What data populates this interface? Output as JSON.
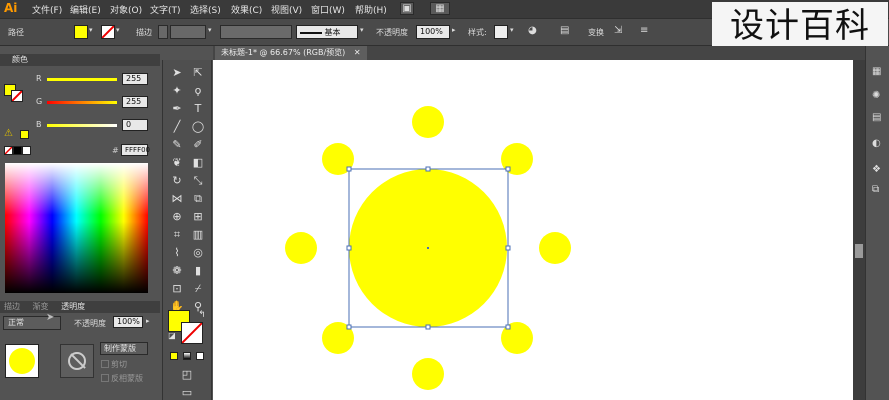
{
  "app": {
    "logo": "Ai"
  },
  "menu": [
    "文件(F)",
    "编辑(E)",
    "对象(O)",
    "文字(T)",
    "选择(S)",
    "效果(C)",
    "视图(V)",
    "窗口(W)",
    "帮助(H)"
  ],
  "control_bar": {
    "selection_label": "路径",
    "fill_color": "#ffff00",
    "stroke_label": "描边",
    "brush_label": "基本",
    "opacity_label": "不透明度",
    "opacity_value": "100%",
    "style_label": "样式:",
    "transform_label": "变换"
  },
  "watermark": "设计百科",
  "color_panel": {
    "title": "颜色",
    "channels": [
      {
        "name": "R",
        "value": "255",
        "color": "#ff3b3b",
        "level": 1.0
      },
      {
        "name": "G",
        "value": "255",
        "color": "#3bff3b",
        "level": 1.0
      },
      {
        "name": "B",
        "value": "0",
        "color": "#3b6bff",
        "level": 0.0
      }
    ],
    "hex_value": "FFFF00"
  },
  "transparency_panel": {
    "tabs": [
      "描边",
      "渐变",
      "透明度"
    ],
    "blend_mode": "正常",
    "opacity_label": "不透明度",
    "opacity_value": "100%",
    "make_mask_button": "制作蒙版",
    "clip_label": "剪切",
    "invert_label": "反相蒙版"
  },
  "document": {
    "tab_title": "未标题-1* @ 66.67% (RGB/预览)"
  },
  "artwork": {
    "fill_color": "#ffff00",
    "selection_color": "#4a6fb5"
  }
}
